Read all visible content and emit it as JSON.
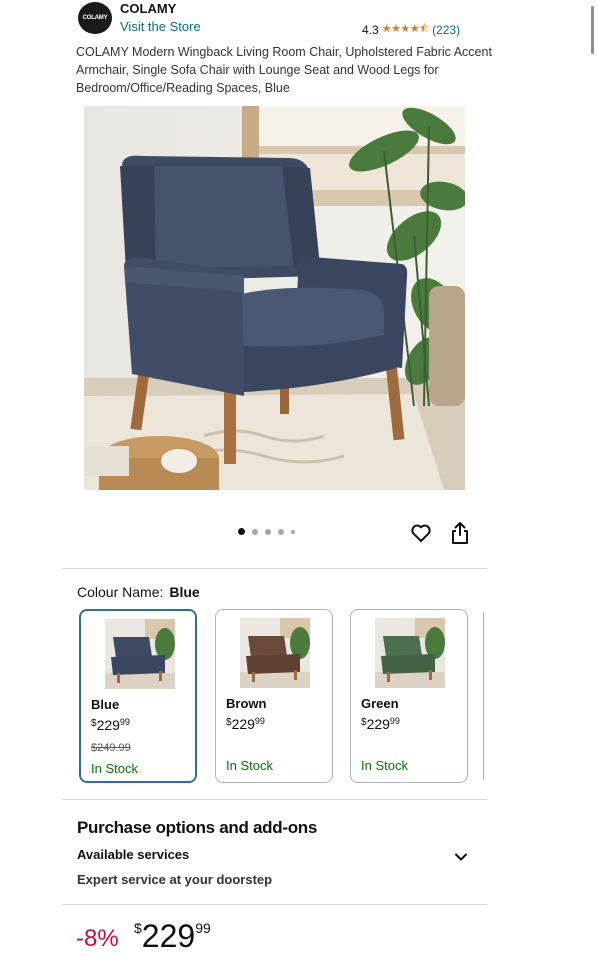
{
  "header": {
    "logo_text": "COLAMY",
    "brand": "COLAMY",
    "store_link": "Visit the Store",
    "rating": "4.3",
    "stars": "★★★★⯪",
    "rating_count": "(223)"
  },
  "product": {
    "title": "COLAMY Modern Wingback Living Room Chair, Upholstered Fabric Accent Armchair, Single Sofa Chair with Lounge Seat and Wood Legs for Bedroom/Office/Reading Spaces, Blue",
    "carousel": {
      "total_dots": 5,
      "active_index": 0
    }
  },
  "icons": {
    "wishlist": "heart-icon",
    "share": "share-icon",
    "expand": "chevron-down-icon"
  },
  "colour": {
    "label": "Colour Name:",
    "selected": "Blue",
    "options": [
      {
        "name": "Blue",
        "currency": "$",
        "price_whole": "229",
        "price_fraction": "99",
        "was": "$249.99",
        "stock": "In Stock",
        "color": "#3e4a62"
      },
      {
        "name": "Brown",
        "currency": "$",
        "price_whole": "229",
        "price_fraction": "99",
        "stock": "In Stock",
        "color": "#6a4a3a"
      },
      {
        "name": "Green",
        "currency": "$",
        "price_whole": "229",
        "price_fraction": "99",
        "stock": "In Stock",
        "color": "#4d6e4f"
      }
    ]
  },
  "purchase_options": {
    "title": "Purchase options and add-ons",
    "subtitle": "Available services",
    "description": "Expert service at your doorstep"
  },
  "price": {
    "discount": "-8%",
    "currency": "$",
    "whole": "229",
    "fraction": "99"
  },
  "colors": {
    "link": "#007185",
    "star": "#de7921",
    "stock": "#007600",
    "discount": "#cc0c39",
    "selected_border": "#2e6ca5"
  }
}
